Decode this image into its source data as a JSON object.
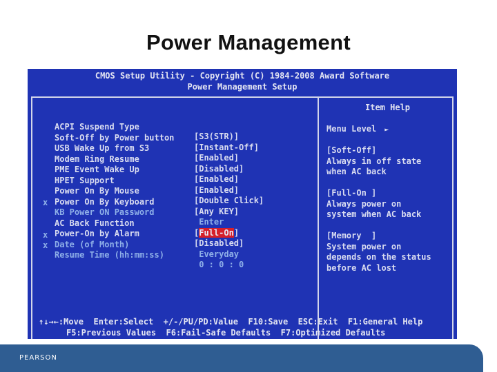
{
  "slide": {
    "title": "Power Management",
    "logo_text": "PEARSON"
  },
  "bios": {
    "header_line1": "CMOS Setup Utility - Copyright (C) 1984-2008 Award Software",
    "header_line2": "Power Management Setup",
    "settings": [
      {
        "mark": "",
        "label": "ACPI Suspend Type",
        "value": "[S3(STR)]",
        "disabled": false
      },
      {
        "mark": "",
        "label": "Soft-Off by Power button",
        "value": "[Instant-Off]",
        "disabled": false
      },
      {
        "mark": "",
        "label": "USB Wake Up from S3",
        "value": "[Enabled]",
        "disabled": false
      },
      {
        "mark": "",
        "label": "Modem Ring Resume",
        "value": "[Disabled]",
        "disabled": false
      },
      {
        "mark": "",
        "label": "PME Event Wake Up",
        "value": "[Enabled]",
        "disabled": false
      },
      {
        "mark": "",
        "label": "HPET Support",
        "value": "[Enabled]",
        "disabled": false
      },
      {
        "mark": "",
        "label": "Power On By Mouse",
        "value": "[Double Click]",
        "disabled": false
      },
      {
        "mark": "",
        "label": "Power On By Keyboard",
        "value": "[Any KEY]",
        "disabled": false
      },
      {
        "mark": "x",
        "label": "KB Power ON Password",
        "value": " Enter",
        "disabled": true
      },
      {
        "mark": "",
        "label": "AC Back Function",
        "value_open": "[",
        "value_highlight": "Full-On",
        "value_close": "]",
        "disabled": false
      },
      {
        "mark": "",
        "label": "Power-On by Alarm",
        "value": "[Disabled]",
        "disabled": false
      },
      {
        "mark": "x",
        "label": "Date (of Month)",
        "value": " Everyday",
        "disabled": true
      },
      {
        "mark": "x",
        "label": "Resume Time (hh:mm:ss)",
        "value": " 0 : 0 : 0",
        "disabled": true
      }
    ],
    "help": {
      "title": "Item Help",
      "menu_level_label": "Menu Level",
      "menu_level_arrow": "►",
      "lines": [
        "[Soft-Off]",
        "Always in off state",
        "when AC back",
        "",
        "[Full-On ]",
        "Always power on",
        "system when AC back",
        "",
        "[Memory  ]",
        "System power on",
        "depends on the status",
        "before AC lost"
      ]
    },
    "footer_line1": "↑↓→←:Move  Enter:Select  +/-/PU/PD:Value  F10:Save  ESC:Exit  F1:General Help",
    "footer_line2": "F5:Previous Values  F6:Fail-Safe Defaults  F7:Optimized Defaults",
    "colors": {
      "background": "#1f33b4",
      "text": "#d9dcf0",
      "dim_text": "#8fb0e8",
      "highlight": "#d61f2a"
    }
  }
}
